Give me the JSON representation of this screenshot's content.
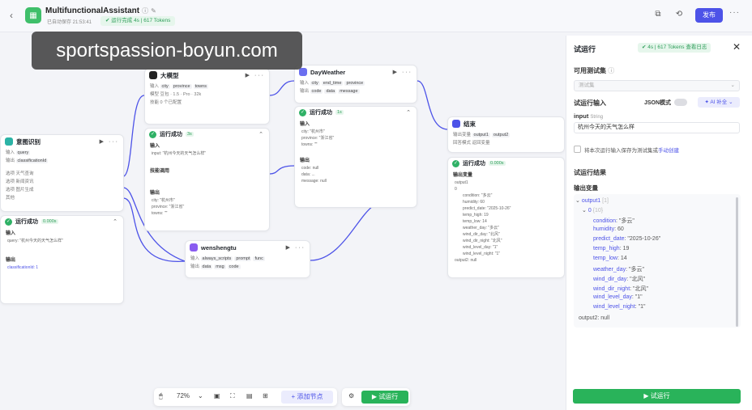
{
  "app": {
    "title": "MultifunctionalAssistant",
    "saved": "已自动保存 21:53:41",
    "run_status": "运行完成 4s | 617 Tokens",
    "publish": "发布"
  },
  "watermark": "sportspassion-boyun.com",
  "nodes": {
    "intent": {
      "title": "意图识别",
      "input_label": "输入",
      "input_field": "query",
      "output_label": "输出",
      "output_field": "classificationId",
      "options_label": "选项",
      "options": [
        "天气查询",
        "新闻资讯",
        "图片生成"
      ],
      "other_label": "其他",
      "result": {
        "title": "运行成功",
        "time": "0.000s",
        "in_label": "输入",
        "in_text": "query: \"杭州今天的天气怎么样\"",
        "out_label": "输出",
        "out_text": "classificationId: 1"
      }
    },
    "llm": {
      "title": "大模型",
      "input_label": "输入",
      "inputs": [
        "city",
        "province",
        "towns"
      ],
      "model_label": "模型",
      "model": "豆包 · 1.5 · Pro · 32k",
      "skill_label": "技能",
      "skill": "0 个已配置",
      "result": {
        "title": "运行成功",
        "time": "3s",
        "in_label": "输入",
        "in_text": "input: \"杭州今天的天气怎么样\"",
        "reason_label": "技能调用",
        "out_label": "输出",
        "out_lines": [
          "city: \"杭州市\"",
          "province: \"浙江省\"",
          "towns: \"\""
        ]
      }
    },
    "weather": {
      "title": "DayWeather",
      "input_label": "输入",
      "inputs": [
        "city",
        "end_time",
        "province"
      ],
      "output_label": "输出",
      "outputs": [
        "code",
        "data",
        "message"
      ],
      "result": {
        "title": "运行成功",
        "time": "1s",
        "in_label": "输入",
        "in_lines": [
          "city: \"杭州市\"",
          "province: \"浙江省\"",
          "towns: \"\""
        ],
        "out_label": "输出",
        "out_lines": [
          "code: null",
          "data: ...",
          "message: null"
        ]
      }
    },
    "image": {
      "title": "wenshengtu",
      "input_label": "输入",
      "inputs": [
        "always_scripts",
        "prompt",
        "func"
      ],
      "output_label": "输出",
      "outputs": [
        "data",
        "msg",
        "code"
      ]
    },
    "end": {
      "title": "结束",
      "input_label": "输出变量",
      "inputs": [
        "output1",
        "output2"
      ],
      "mode_label": "回答模式",
      "mode": "返回变量",
      "result": {
        "title": "运行成功",
        "time": "0.000s",
        "out_label": "输出变量",
        "lines": [
          "output1",
          "0",
          "condition: \"多云\"",
          "humidity: 60",
          "predict_date: \"2025-10-26\"",
          "temp_high: 19",
          "temp_low: 14",
          "weather_day: \"多云\"",
          "wind_dir_day: \"北风\"",
          "wind_dir_night: \"北风\"",
          "wind_level_day: \"1\"",
          "wind_level_night: \"1\"",
          "output2: null"
        ]
      }
    }
  },
  "panel": {
    "title": "试运行",
    "tokens": "4s | 617 Tokens  查看日志",
    "dataset_label": "可用测试集",
    "dataset_placeholder": "测试集",
    "input_section": "试运行输入",
    "json_mode": "JSON模式",
    "ai_fill": "AI 补全",
    "input_name": "input",
    "input_type": "String",
    "input_value": "杭州今天的天气怎么样",
    "save_text": "将本次运行输入保存为测试集或",
    "save_link": "手动创建",
    "result_section": "试运行结果",
    "output_vars": "输出变量",
    "output": {
      "output1": "output1",
      "output1_meta": "[1]",
      "idx": "0",
      "idx_meta": "{10}",
      "fields": [
        {
          "key": "condition",
          "value": "\"多云\""
        },
        {
          "key": "humidity",
          "value": "60"
        },
        {
          "key": "predict_date",
          "value": "\"2025-10-26\""
        },
        {
          "key": "temp_high",
          "value": "19"
        },
        {
          "key": "temp_low",
          "value": "14"
        },
        {
          "key": "weather_day",
          "value": "\"多云\""
        },
        {
          "key": "wind_dir_day",
          "value": "\"北风\""
        },
        {
          "key": "wind_dir_night",
          "value": "\"北风\""
        },
        {
          "key": "wind_level_day",
          "value": "\"1\""
        },
        {
          "key": "wind_level_night",
          "value": "\"1\""
        }
      ],
      "output2": "output2: null"
    },
    "run_button": "试运行"
  },
  "toolbar": {
    "zoom": "72%",
    "add_node": "添加节点",
    "run": "试运行"
  },
  "colors": {
    "accent": "#4d53e8",
    "success": "#29b35a"
  }
}
